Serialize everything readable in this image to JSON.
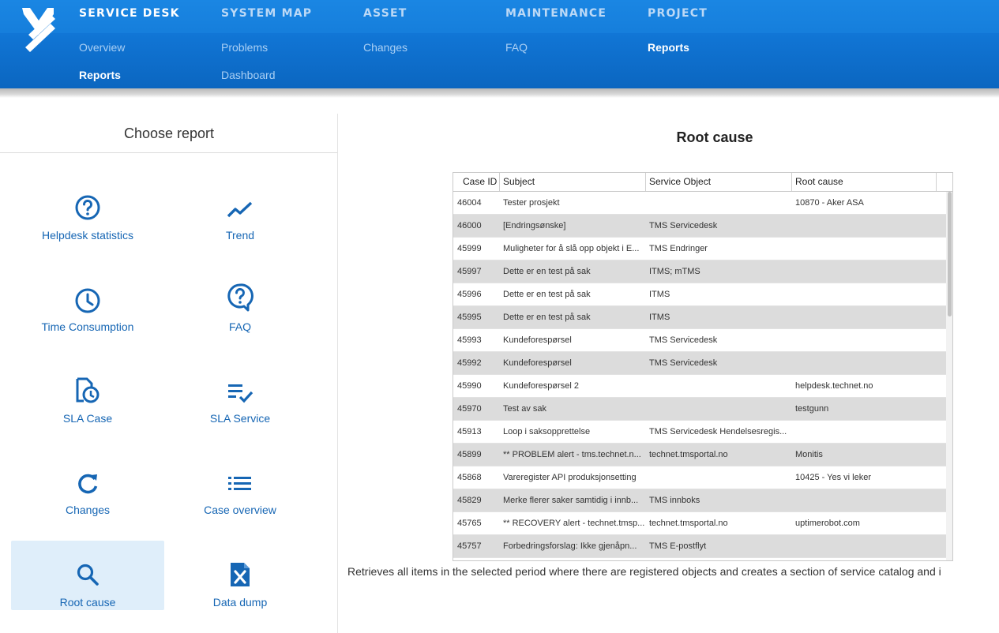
{
  "nav": {
    "brand_logo": "mtms-logo",
    "menus": [
      {
        "header": "SERVICE DESK",
        "items": [
          "Overview",
          "Reports"
        ]
      },
      {
        "header": "SYSTEM MAP",
        "items": [
          "Problems",
          "Dashboard"
        ]
      },
      {
        "header": "ASSET",
        "items": [
          "Changes"
        ]
      },
      {
        "header": "MAINTENANCE",
        "items": [
          "FAQ"
        ]
      },
      {
        "header": "PROJECT",
        "items": [
          "Reports"
        ]
      }
    ],
    "active_header": "SERVICE DESK",
    "active_item": "Reports"
  },
  "left_panel": {
    "title": "Choose report",
    "reports": [
      {
        "label": "Helpdesk statistics",
        "icon": "question-circle-icon"
      },
      {
        "label": "Trend",
        "icon": "trend-line-icon"
      },
      {
        "label": "Time Consumption",
        "icon": "clock-icon"
      },
      {
        "label": "FAQ",
        "icon": "question-bubble-icon"
      },
      {
        "label": "SLA Case",
        "icon": "document-clock-icon"
      },
      {
        "label": "SLA Service",
        "icon": "list-check-icon"
      },
      {
        "label": "Changes",
        "icon": "refresh-icon"
      },
      {
        "label": "Case overview",
        "icon": "bulleted-list-icon"
      },
      {
        "label": "Root cause",
        "icon": "search-icon",
        "selected": true
      },
      {
        "label": "Data dump",
        "icon": "excel-file-icon"
      }
    ]
  },
  "report": {
    "title": "Root cause",
    "columns": [
      "Case ID",
      "Subject",
      "Service Object",
      "Root cause"
    ],
    "rows": [
      [
        "46004",
        "Tester prosjekt",
        "",
        "10870 - Aker ASA"
      ],
      [
        "46000",
        "[Endringsønske]",
        "TMS Servicedesk",
        ""
      ],
      [
        "45999",
        "Muligheter for å slå opp objekt i E...",
        "TMS Endringer",
        ""
      ],
      [
        "45997",
        "Dette er en test på sak",
        "ITMS; mTMS",
        ""
      ],
      [
        "45996",
        "Dette er en test på sak",
        "ITMS",
        ""
      ],
      [
        "45995",
        "Dette er en test på sak",
        "ITMS",
        ""
      ],
      [
        "45993",
        "Kundeforespørsel",
        "TMS Servicedesk",
        ""
      ],
      [
        "45992",
        "Kundeforespørsel",
        "TMS Servicedesk",
        ""
      ],
      [
        "45990",
        "Kundeforespørsel 2",
        "",
        "helpdesk.technet.no"
      ],
      [
        "45970",
        "Test av sak",
        "",
        "testgunn"
      ],
      [
        "45913",
        "Loop i saksopprettelse",
        "TMS Servicedesk Hendelsesregis...",
        ""
      ],
      [
        "45899",
        "** PROBLEM alert - tms.technet.n...",
        "technet.tmsportal.no",
        "Monitis"
      ],
      [
        "45868",
        "Vareregister API produksjonsetting",
        "",
        "10425 - Yes vi leker"
      ],
      [
        "45829",
        "Merke flerer saker samtidig i innb...",
        "TMS innboks",
        ""
      ],
      [
        "45765",
        "** RECOVERY alert - technet.tmsp...",
        "technet.tmsportal.no",
        "uptimerobot.com"
      ],
      [
        "45757",
        "Forbedringsforslag: Ikke gjenåpn...",
        "TMS E-postflyt",
        ""
      ]
    ],
    "description": "Retrieves all items in the selected period where there are registered objects and creates a section of service catalog and i"
  },
  "colors": {
    "nav_bg": "#0f72cf",
    "link_blue": "#1666b4",
    "selected_tile_bg": "#dfeefa",
    "row_alt_bg": "#dcdcdc"
  }
}
